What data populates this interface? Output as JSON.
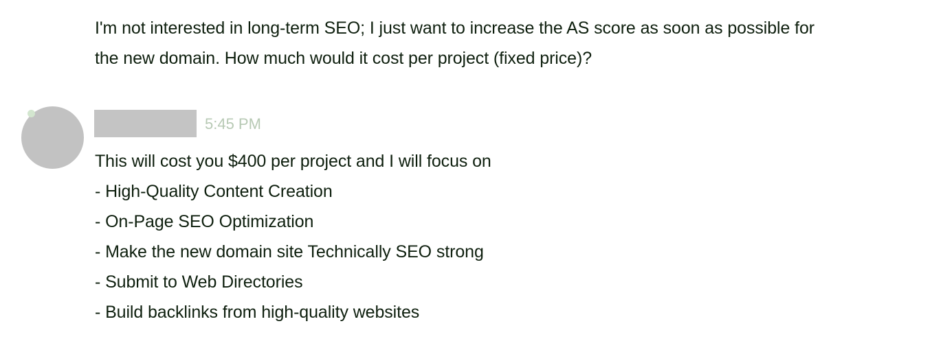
{
  "previous_message": {
    "lines": [
      "I'm not interested in long-term SEO; I just want to increase the AS score as soon as possible for",
      "the new domain. How much would it cost per project (fixed price)?"
    ]
  },
  "reply": {
    "timestamp": "5:45 PM",
    "lines": [
      "This will cost you $400 per project and I will focus on",
      "- High-Quality Content Creation",
      "- On-Page SEO Optimization",
      "- Make the new domain site Technically SEO strong",
      "- Submit to Web Directories",
      "- Build backlinks from high-quality websites"
    ]
  },
  "colors": {
    "text": "#0e1f0e",
    "timestamp": "#b7c9b4",
    "avatar": "#c2c2c2",
    "redaction": "#c4c4c4",
    "status_dot": "#d3e6cf"
  }
}
